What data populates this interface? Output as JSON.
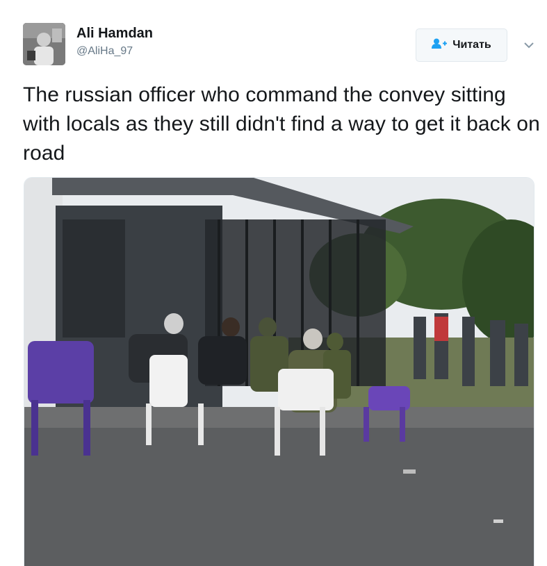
{
  "author": {
    "name": "Ali Hamdan",
    "handle": "@AliHa_97",
    "avatar_icon": "profile-photo"
  },
  "follow_button": {
    "label": "Читать",
    "icon": "add-user-icon",
    "accent": "#1da1f2"
  },
  "menu": {
    "icon": "chevron-down-icon"
  },
  "tweet": {
    "text": "The russian officer who command the convey sitting with locals as they still didn't find a way to get it back on road"
  },
  "media": {
    "type": "photo",
    "subject": "people-seated-on-plastic-chairs-under-shelter"
  },
  "colors": {
    "text": "#14171a",
    "secondary": "#657786",
    "border": "#e1e8ed",
    "button_bg": "#f5f8fa"
  }
}
